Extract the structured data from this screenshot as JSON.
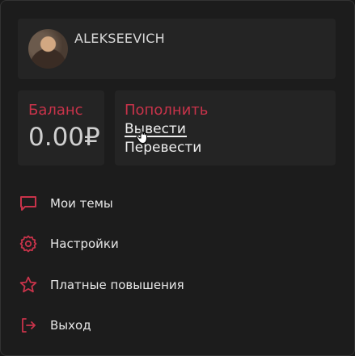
{
  "user": {
    "name": "ALEKSEEVICH"
  },
  "balance": {
    "label": "Баланс",
    "value": "0.00₽"
  },
  "actions": {
    "top_up": "Пополнить",
    "withdraw": "Вывести",
    "transfer": "Перевести"
  },
  "menu": {
    "items": [
      {
        "label": "Мои темы",
        "icon": "chat-bubble-icon"
      },
      {
        "label": "Настройки",
        "icon": "gear-icon"
      },
      {
        "label": "Платные повышения",
        "icon": "star-icon"
      },
      {
        "label": "Выход",
        "icon": "logout-icon"
      }
    ]
  },
  "colors": {
    "accent": "#c8334a",
    "background": "#1c1c1c",
    "card": "#242424"
  }
}
